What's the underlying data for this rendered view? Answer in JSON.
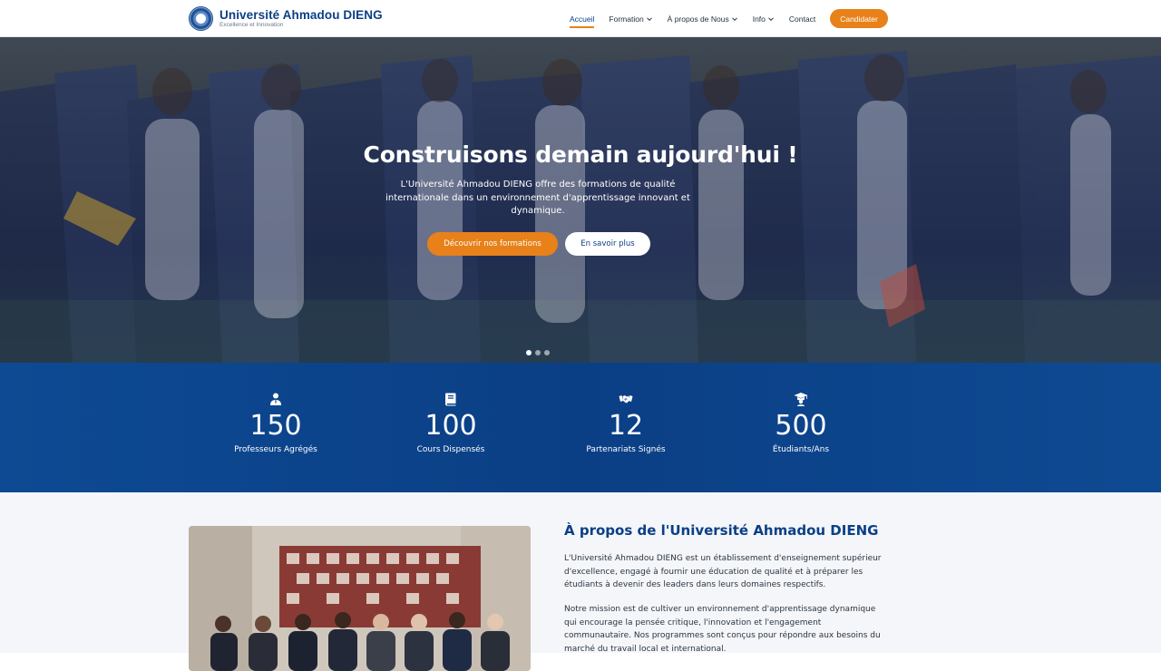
{
  "brand": {
    "name": "Université Ahmadou DIENG",
    "tagline": "Excellence et Innovation"
  },
  "nav": {
    "items": [
      {
        "label": "Accueil",
        "active": true,
        "dropdown": false
      },
      {
        "label": "Formation",
        "active": false,
        "dropdown": true
      },
      {
        "label": "À propos de Nous",
        "active": false,
        "dropdown": true
      },
      {
        "label": "Info",
        "active": false,
        "dropdown": true
      },
      {
        "label": "Contact",
        "active": false,
        "dropdown": false
      }
    ],
    "cta_label": "Candidater"
  },
  "hero": {
    "title": "Construisons demain aujourd'hui !",
    "subtitle": "L'Université Ahmadou DIENG offre des formations de qualité internationale dans un environnement d'apprentissage innovant et dynamique.",
    "primary_button": "Découvrir nos formations",
    "secondary_button": "En savoir plus",
    "slide_count": 3,
    "active_slide": 1
  },
  "stats": [
    {
      "icon": "professor-icon",
      "value": "150",
      "label": "Professeurs Agrégés"
    },
    {
      "icon": "book-icon",
      "value": "100",
      "label": "Cours Dispensés"
    },
    {
      "icon": "handshake-icon",
      "value": "12",
      "label": "Partenariats Signés"
    },
    {
      "icon": "graduation-cap-icon",
      "value": "500",
      "label": "Étudiants/Ans"
    }
  ],
  "about": {
    "title": "À propos de l'Université Ahmadou DIENG",
    "paragraph1": "L'Université Ahmadou DIENG est un établissement d'enseignement supérieur d'excellence, engagé à fournir une éducation de qualité et à préparer les étudiants à devenir des leaders dans leurs domaines respectifs.",
    "paragraph2": "Notre mission est de cultiver un environnement d'apprentissage dynamique qui encourage la pensée critique, l'innovation et l'engagement communautaire. Nos programmes sont conçus pour répondre aux besoins du marché du travail local et international."
  },
  "colors": {
    "primary": "#0b3f85",
    "accent": "#e8811a",
    "text": "#2b3440"
  }
}
